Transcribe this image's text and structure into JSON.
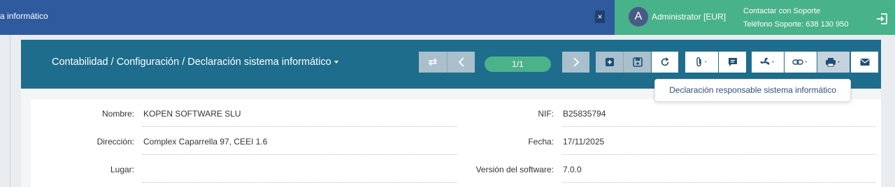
{
  "topbar": {
    "title": "a informático",
    "close_label": "×",
    "avatar_letter": "A",
    "user": "Administrator [EUR]",
    "support_title": "Contactar con Soporte",
    "support_phone": "Teléfono Soporte: 638 130 950"
  },
  "header": {
    "breadcrumb": "Contabilidad / Configuración / Declaración sistema informático",
    "pager": "1/1"
  },
  "tooltip": "Declaración responsable sistema informático",
  "form": {
    "nombre_label": "Nombre:",
    "nombre_value": "KOPEN SOFTWARE SLU",
    "nif_label": "NIF:",
    "nif_value": "B25835794",
    "direccion_label": "Dirección:",
    "direccion_value": "Complex Caparrella 97, CEEI 1.6",
    "fecha_label": "Fecha:",
    "fecha_value": "17/11/2025",
    "lugar_label": "Lugar:",
    "lugar_value": "",
    "version_label": "Versión del software:",
    "version_value": "7.0.0"
  },
  "colors": {
    "topbar_blue": "#2f5b9e",
    "topbar_green": "#48b28a",
    "header_teal": "#1e6d8c",
    "pager_green": "#4cb28a"
  }
}
